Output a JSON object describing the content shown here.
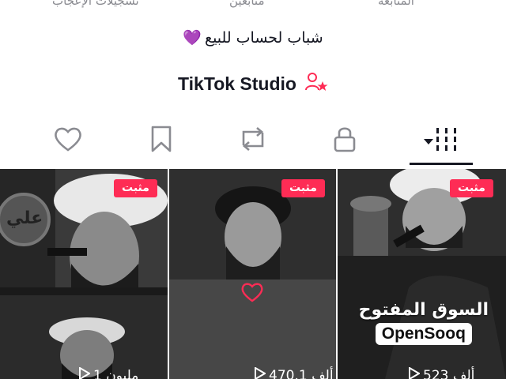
{
  "stats": {
    "likes_label": "تسجيلات الإعجاب",
    "followers_label": "متابعين",
    "following_label": "المتابعة"
  },
  "bio": {
    "text": "شباب لحساب للبيع",
    "emoji": "💜"
  },
  "studio": {
    "label": "TikTok Studio"
  },
  "tabs": [
    "liked",
    "favorites",
    "reposts",
    "private",
    "videos"
  ],
  "videos": [
    {
      "pinned_label": "مثبت",
      "views": "1 مليون"
    },
    {
      "pinned_label": "مثبت",
      "views": "470.1 ألف"
    },
    {
      "pinned_label": "مثبت",
      "views": "523 ألف"
    }
  ],
  "thumb_text": {
    "ali": "علي"
  },
  "watermark": {
    "arabic": "السوق المفتوح",
    "english": "OpenSooq"
  },
  "colors": {
    "pin": "#fe2c55",
    "accent_heart": "#8e3fd6",
    "studio_star": "#fe2c55"
  }
}
